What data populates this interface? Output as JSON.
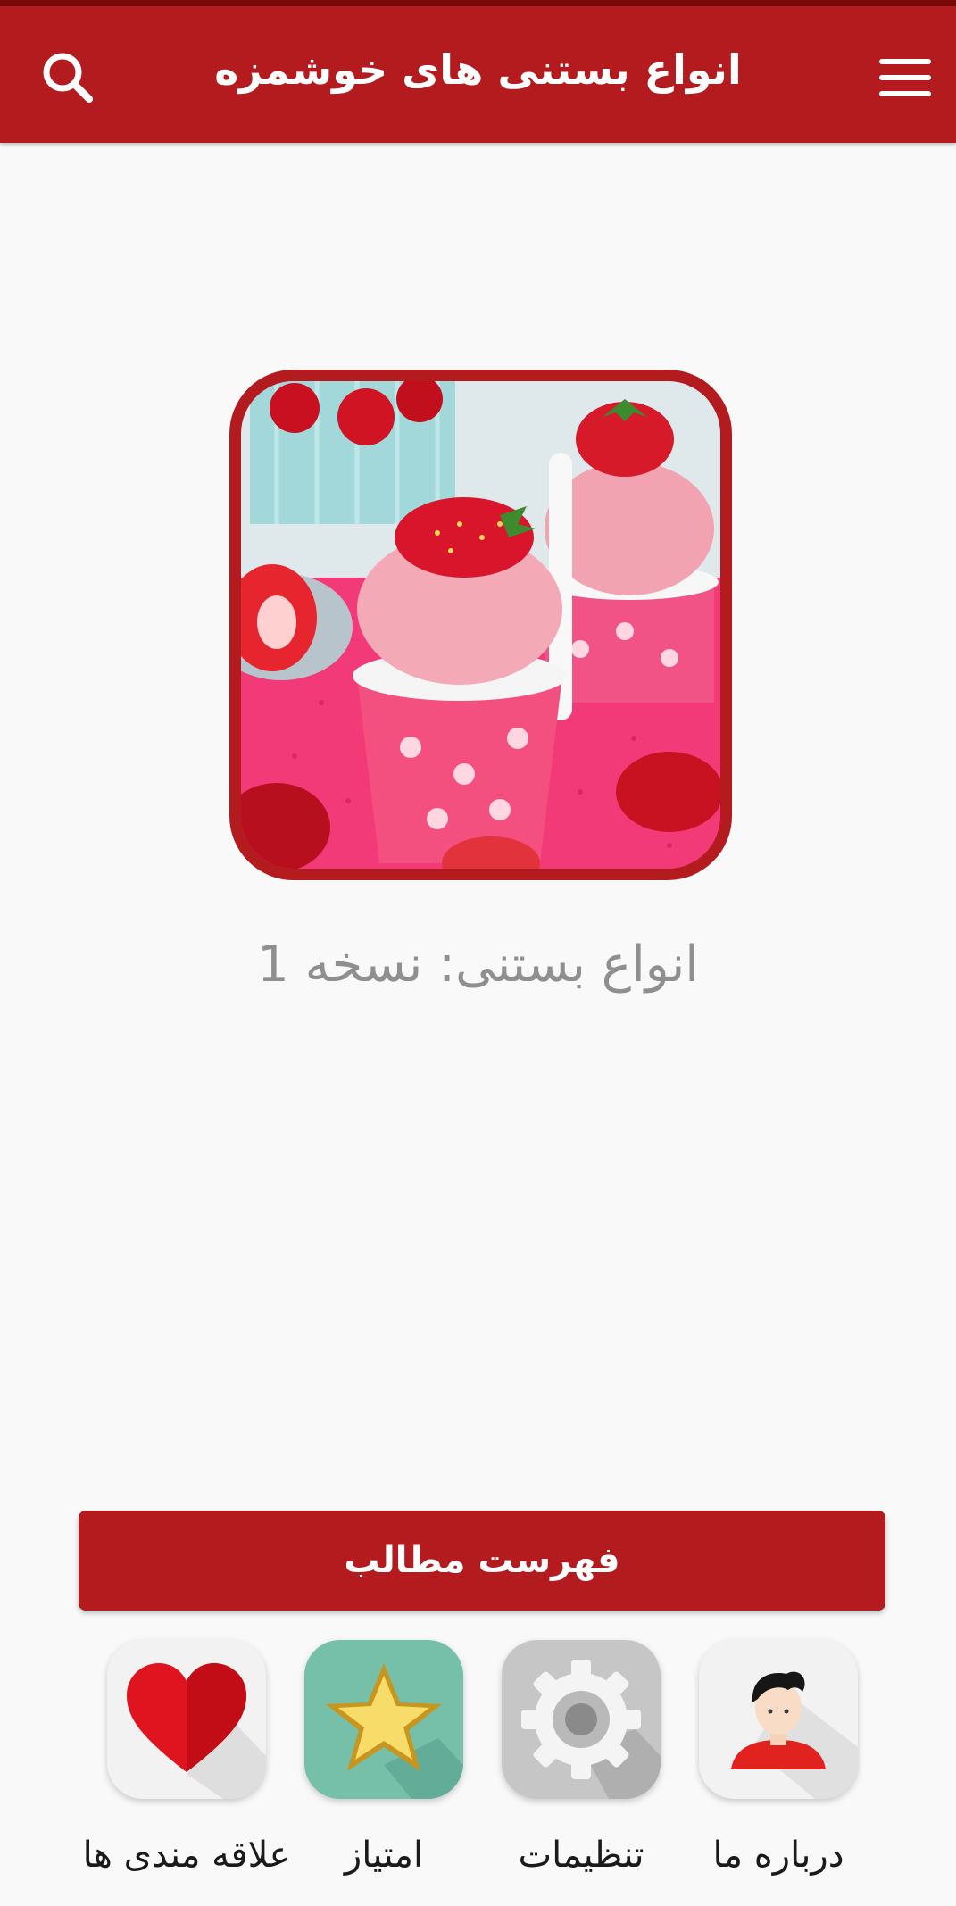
{
  "appbar": {
    "title": "انواع بستنی های خوشمزه",
    "search_icon": "search-icon",
    "menu_icon": "menu-icon",
    "color": "#b31b1e"
  },
  "hero": {
    "image": "strawberry-ice-cream-photo",
    "version_text": "انواع بستنی: نسخه 1"
  },
  "toc_button": {
    "label": "فهرست مطالب"
  },
  "shortcuts": [
    {
      "label": "علاقه مندی ها",
      "icon": "heart-icon"
    },
    {
      "label": "امتیاز",
      "icon": "star-icon"
    },
    {
      "label": "تنظیمات",
      "icon": "gear-icon"
    },
    {
      "label": "درباره ما",
      "icon": "user-icon"
    }
  ]
}
